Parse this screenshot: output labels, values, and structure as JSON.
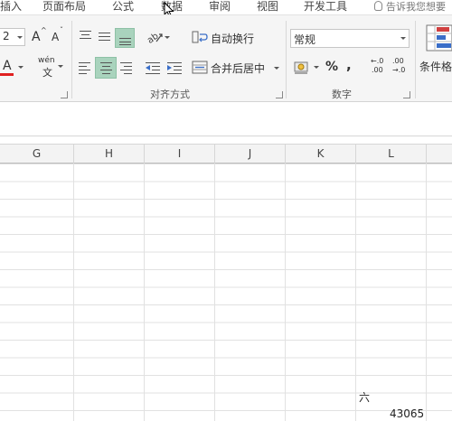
{
  "ribbon_tabs": [
    "插入",
    "页面布局",
    "公式",
    "数据",
    "审阅",
    "视图",
    "开发工具"
  ],
  "tell_me": "告诉我您想要",
  "font": {
    "size_value": "2",
    "grow_label": "A",
    "shrink_label": "A",
    "color_label": "A",
    "phonetic_label": "wén",
    "phonetic_sub": "文"
  },
  "alignment": {
    "wrap_text": "自动换行",
    "merge_center": "合并后居中",
    "group_label": "对齐方式"
  },
  "number": {
    "format_value": "常规",
    "percent": "%",
    "comma": ",",
    "inc_decimal_top": "←.0",
    "inc_decimal_bottom": ".00",
    "dec_decimal_top": ".00",
    "dec_decimal_bottom": "→.0",
    "group_label": "数字"
  },
  "styles": {
    "conditional_format": "条件格"
  },
  "columns": [
    "G",
    "H",
    "I",
    "J",
    "K",
    "L"
  ],
  "cells": {
    "l_char": "六",
    "l_number": "43065"
  },
  "colors": {
    "active_toggle": "#a9d3bd",
    "font_color_bar": "#e02020",
    "fill_color_bar": "#f0d000"
  }
}
